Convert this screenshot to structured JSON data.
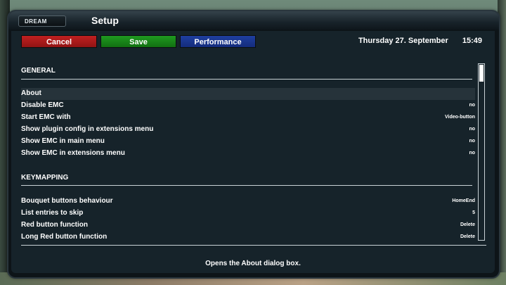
{
  "header": {
    "logo": "DREAM",
    "title": "Setup"
  },
  "buttons": {
    "cancel": "Cancel",
    "save": "Save",
    "performance": "Performance"
  },
  "datetime": {
    "date": "Thursday 27. September",
    "time": "15:49"
  },
  "colors": {
    "red": "#b01a1a",
    "green": "#188818",
    "blue": "#1a3690",
    "background": "#16232a"
  },
  "sections": [
    {
      "title": "GENERAL",
      "items": [
        {
          "label": "About",
          "value": ""
        },
        {
          "label": "Disable EMC",
          "value": "no"
        },
        {
          "label": "Start EMC with",
          "value": "Video-button"
        },
        {
          "label": "Show plugin config in extensions menu",
          "value": "no"
        },
        {
          "label": "Show EMC in main menu",
          "value": "no"
        },
        {
          "label": "Show EMC in extensions menu",
          "value": "no"
        }
      ]
    },
    {
      "title": "KEYMAPPING",
      "items": [
        {
          "label": "Bouquet buttons behaviour",
          "value": "HomeEnd"
        },
        {
          "label": "List entries to skip",
          "value": "5"
        },
        {
          "label": "Red button function",
          "value": "Delete"
        },
        {
          "label": "Long Red button function",
          "value": "Delete"
        }
      ]
    }
  ],
  "selected_item": "About",
  "help_text": "Opens the About dialog box."
}
